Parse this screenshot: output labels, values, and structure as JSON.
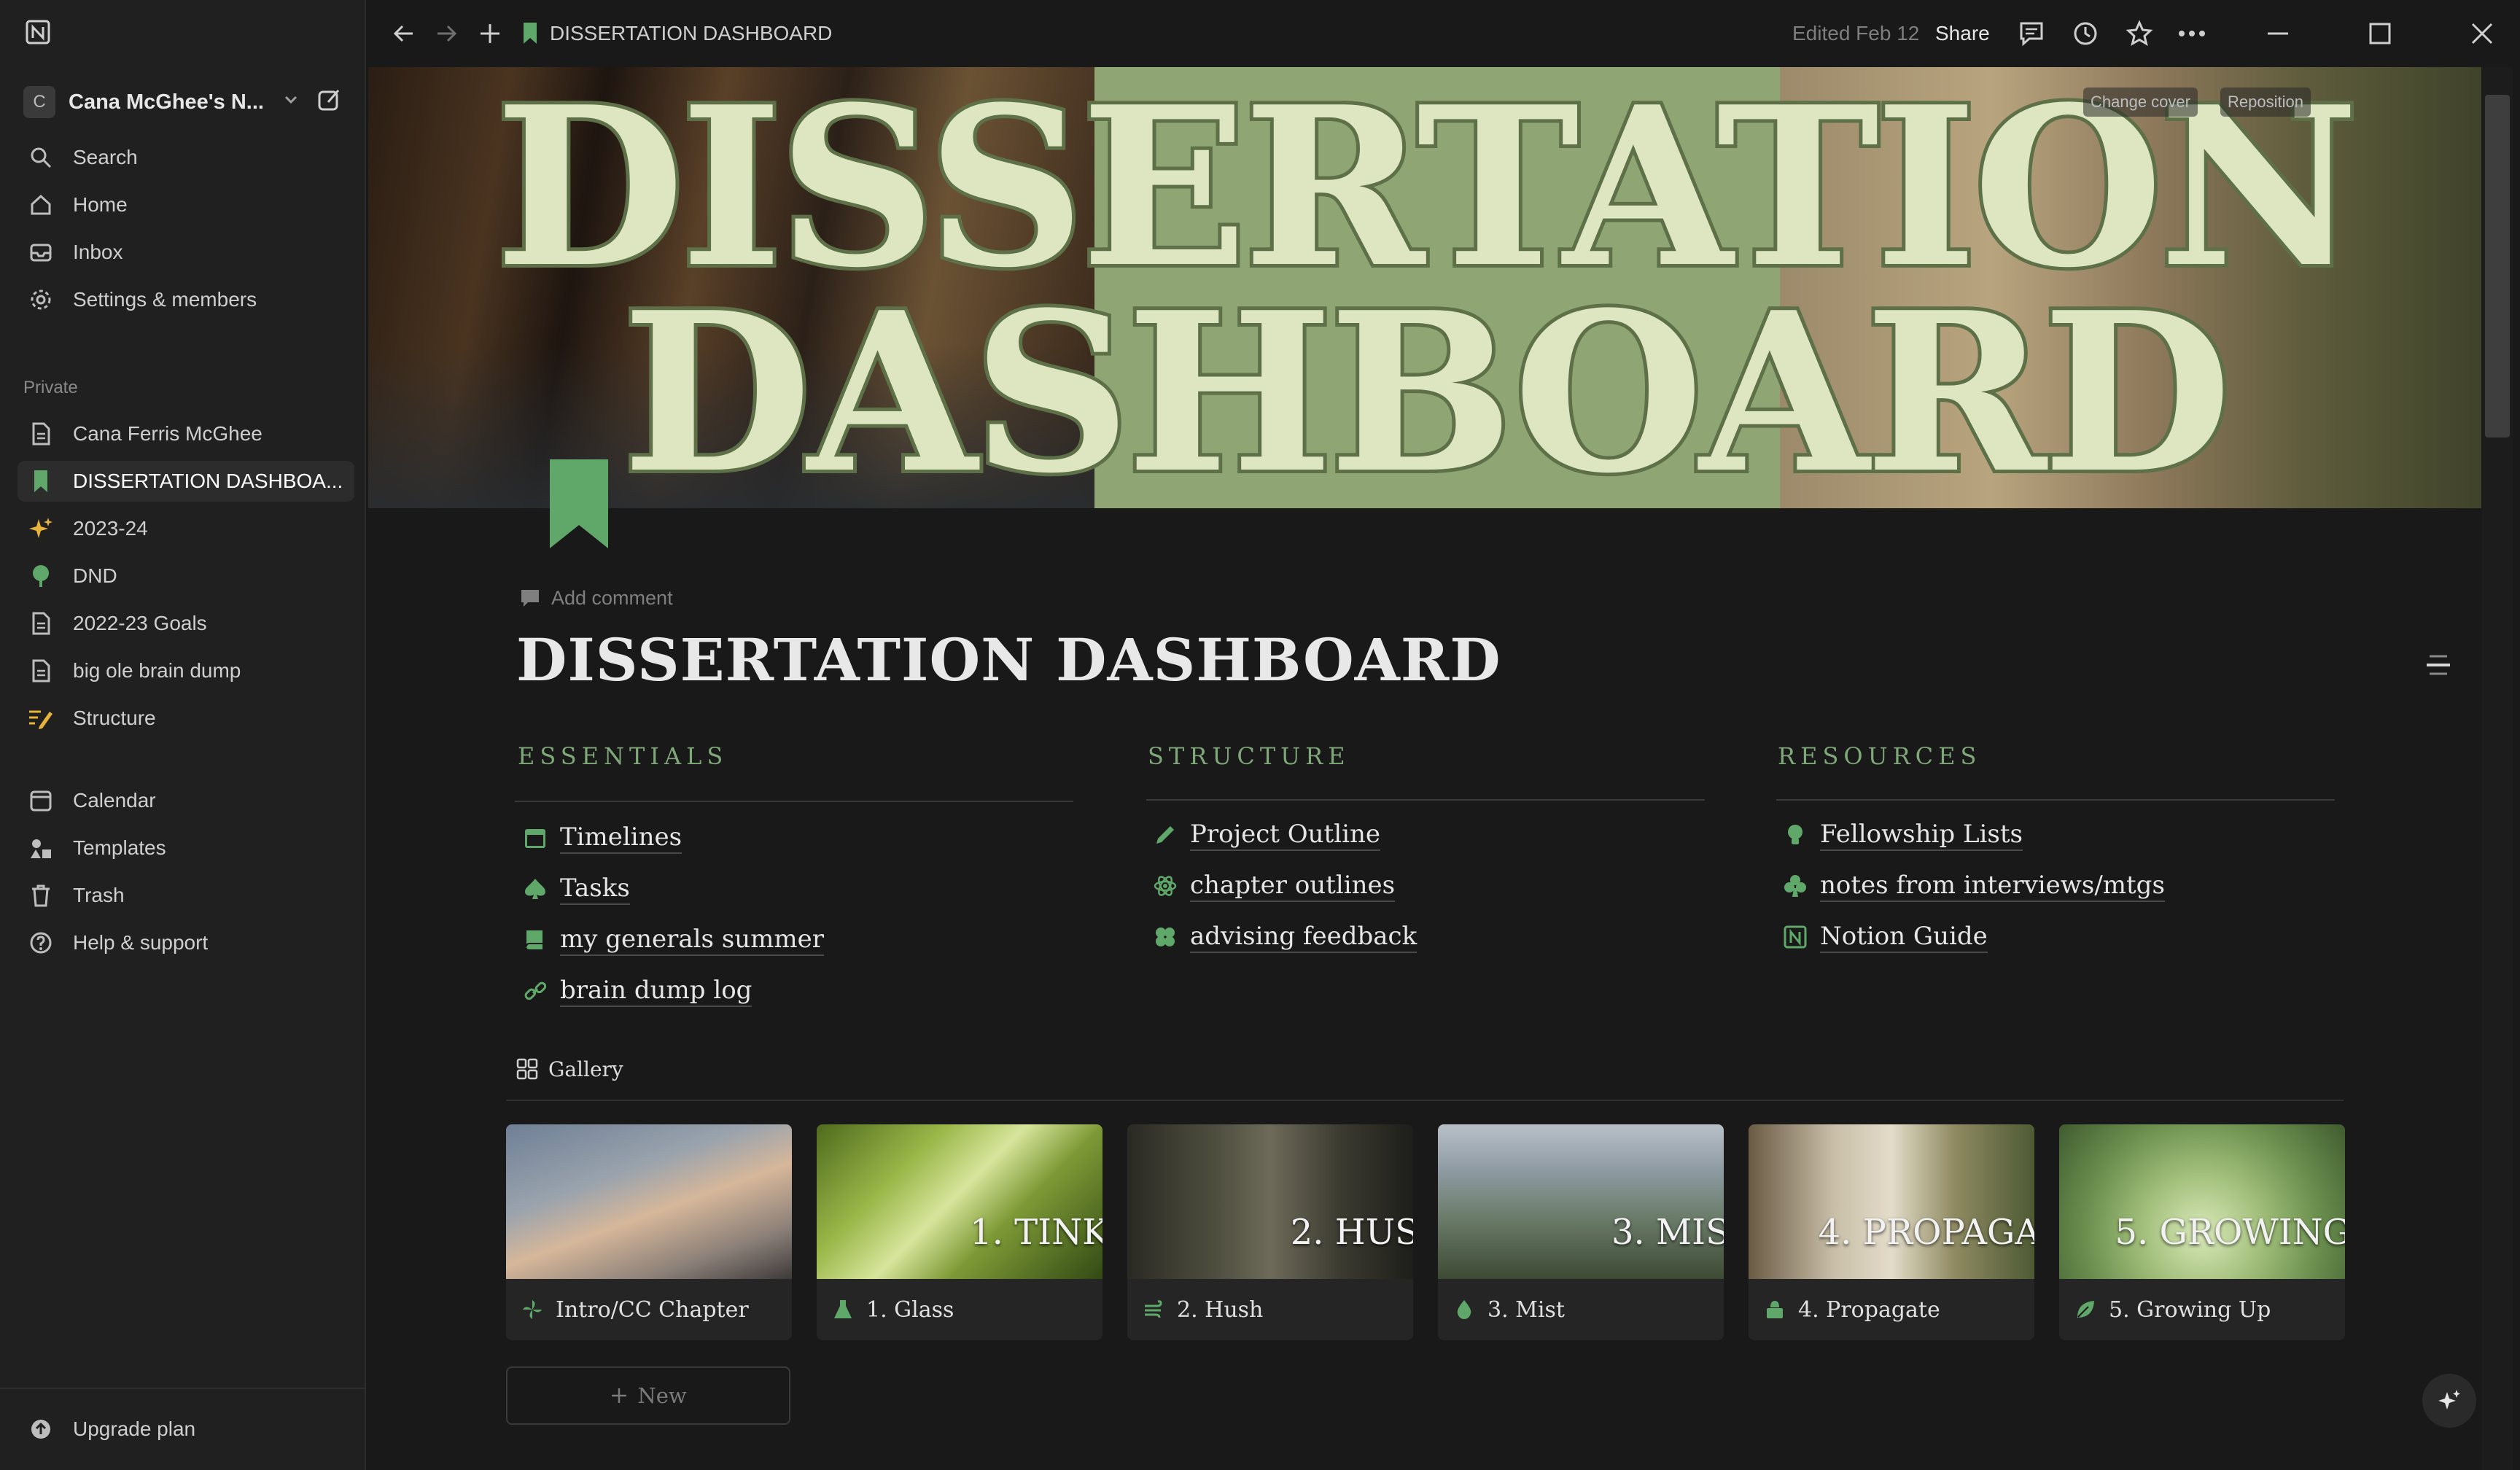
{
  "colors": {
    "accent_green": "#7fa879",
    "icon_green": "#5fa86a",
    "background": "#191919",
    "sidebar": "#202020"
  },
  "sidebar": {
    "workspace": {
      "avatar_letter": "C",
      "name": "Cana McGhee's N..."
    },
    "top_items": [
      {
        "label": "Search",
        "icon": "search-icon"
      },
      {
        "label": "Home",
        "icon": "home-icon"
      },
      {
        "label": "Inbox",
        "icon": "inbox-icon"
      },
      {
        "label": "Settings & members",
        "icon": "gear-icon"
      }
    ],
    "private_label": "Private",
    "pages": [
      {
        "label": "Cana Ferris McGhee",
        "icon": "page-icon"
      },
      {
        "label": "DISSERTATION DASHBOA...",
        "icon": "bookmark-icon",
        "active": true
      },
      {
        "label": "2023-24",
        "icon": "sparkle-icon"
      },
      {
        "label": "DND",
        "icon": "tree-icon"
      },
      {
        "label": "2022-23 Goals",
        "icon": "page-icon"
      },
      {
        "label": "big ole brain dump",
        "icon": "page-icon"
      },
      {
        "label": "Structure",
        "icon": "edit-list-icon"
      }
    ],
    "bottom_items": [
      {
        "label": "Calendar",
        "icon": "calendar-icon"
      },
      {
        "label": "Templates",
        "icon": "templates-icon"
      },
      {
        "label": "Trash",
        "icon": "trash-icon"
      },
      {
        "label": "Help & support",
        "icon": "help-icon"
      }
    ],
    "upgrade": "Upgrade plan"
  },
  "topbar": {
    "breadcrumb": "DISSERTATION DASHBOARD",
    "edited": "Edited Feb 12",
    "share": "Share"
  },
  "cover": {
    "line1": "DISSERTATION",
    "line2": "DASHBOARD",
    "change_cover": "Change cover",
    "reposition": "Reposition"
  },
  "page": {
    "add_comment": "Add comment",
    "title": "DISSERTATION DASHBOARD"
  },
  "columns": [
    {
      "heading": "ESSENTIALS",
      "links": [
        {
          "label": "Timelines",
          "icon": "calendar-icon"
        },
        {
          "label": "Tasks",
          "icon": "spade-icon"
        },
        {
          "label": "my generals summer",
          "icon": "book-icon"
        },
        {
          "label": "brain dump log",
          "icon": "link-icon"
        }
      ]
    },
    {
      "heading": "STRUCTURE",
      "links": [
        {
          "label": "Project Outline",
          "icon": "pencil-icon"
        },
        {
          "label": "chapter outlines",
          "icon": "atom-icon"
        },
        {
          "label": "advising feedback",
          "icon": "clover-icon"
        }
      ]
    },
    {
      "heading": "RESOURCES",
      "links": [
        {
          "label": "Fellowship Lists",
          "icon": "lightbulb-icon"
        },
        {
          "label": "notes from interviews/mtgs",
          "icon": "club-icon"
        },
        {
          "label": "Notion Guide",
          "icon": "notion-icon"
        }
      ]
    }
  ],
  "gallery": {
    "tab_label": "Gallery",
    "new_label": "New",
    "cards": [
      {
        "caption": "Intro/CC Chapter",
        "overlay": "",
        "icon": "wind-icon",
        "bg": "linear-gradient(160deg,#6f7f96 0%,#9aa3ad 35%,#d6b79a 55%,#8a7f78 80%,#3e3a3a 100%)"
      },
      {
        "caption": "1. Glass",
        "overlay": "1. TINK",
        "icon": "flask-icon",
        "bg": "linear-gradient(135deg,#4f6a1c 0%,#9bb84a 30%,#d7e59c 48%,#7e9a36 65%,#324a14 100%)"
      },
      {
        "caption": "2. Hush",
        "overlay": "2. HUS",
        "icon": "wind-lines-icon",
        "bg": "linear-gradient(90deg,#2a2a24 0%,#4d4d3e 30%,#6d6a58 50%,#3b3a30 75%,#1e1e1a 100%)"
      },
      {
        "caption": "3. Mist",
        "overlay": "3. MIS",
        "icon": "droplet-icon",
        "bg": "linear-gradient(180deg,#b8c0c8 0%,#8e9aa2 30%,#6b7c6a 60%,#3d4a34 100%)"
      },
      {
        "caption": "4. Propagate",
        "overlay": "4. PROPAGA",
        "icon": "planter-icon",
        "bg": "linear-gradient(90deg,#6a5a44 0%,#c9bfa8 30%,#e3dcc9 50%,#8f8a62 72%,#4e5a34 100%)"
      },
      {
        "caption": "5. Growing Up",
        "overlay": "5. GROWING",
        "icon": "leaf-icon",
        "bg": "radial-gradient(circle at 50% 70%,#d9e8b9 0%,#9fbd78 35%,#6b8f4f 65%,#3f5b2f 100%)"
      }
    ]
  }
}
